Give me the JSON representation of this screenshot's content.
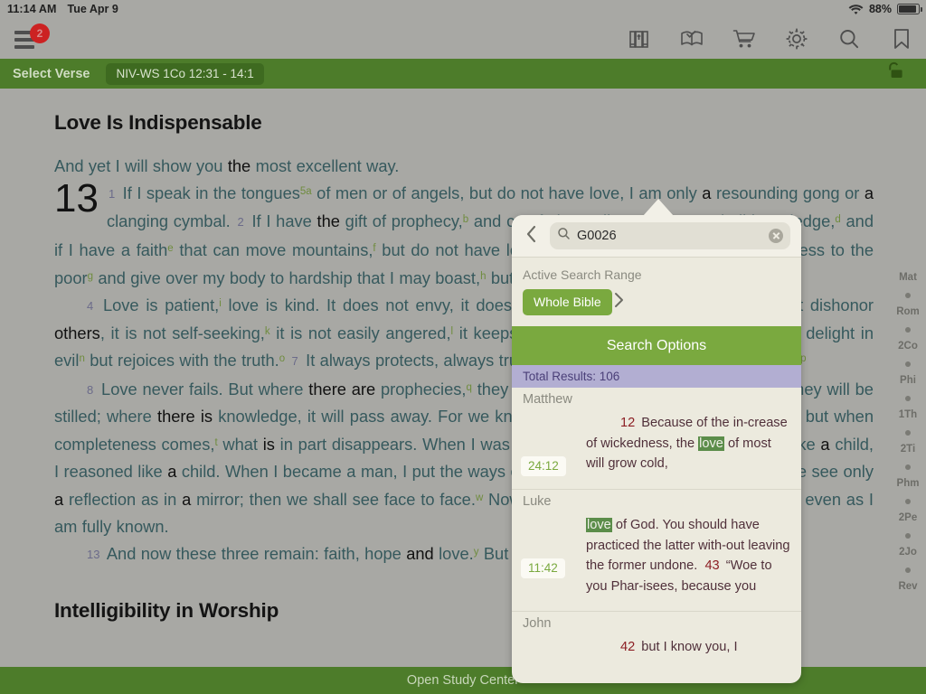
{
  "status_bar": {
    "time": "11:14 AM",
    "date": "Tue Apr 9",
    "battery_percent": "88%",
    "wifi_icon": "wifi-icon",
    "battery_icon": "battery-icon"
  },
  "toolbar": {
    "menu_icon": "hamburger-menu-icon",
    "notification_count": "2",
    "icons": [
      {
        "name": "library-books-icon",
        "label": "Library"
      },
      {
        "name": "study-book-check-icon",
        "label": "Reading Plan"
      },
      {
        "name": "shopping-cart-icon",
        "label": "Store"
      },
      {
        "name": "gear-icon",
        "label": "Settings"
      },
      {
        "name": "search-icon",
        "label": "Search"
      },
      {
        "name": "bookmark-icon",
        "label": "Bookmarks"
      }
    ]
  },
  "verse_bar": {
    "select_verse_label": "Select Verse",
    "reference_chip": "NIV-WS 1Co 12:31 - 14:1",
    "lock_icon": "unlocked-padlock-icon",
    "bar_color": "#4d7c2a"
  },
  "bible": {
    "section_title_1": "Love Is Indispensable",
    "section_title_2": "Intelligibility in Worship",
    "chapter_number": "13",
    "intro_line": "And yet I will show you the most excellent way.",
    "paragraph_1": "If I speak in the tongues5a of men or of angels, but do not have love, I am only a resounding gong or a clanging cymbal. 2 If I have the gift of prophecy,b and can fathom all mysteriesc and all knowledge,d and if I have a faithe that can move mountains,f but do not have love, I am nothing. 3 If I give all I possess to the poorg and give over my body to hardship that I may boast,h but do not have love, I gain nothing.",
    "paragraph_2": "4 Love is patient,i love is kind. It does not envy, it does not boast, it is not proud.j It does not dishonor others, it is not self-seeking,k it is not easily angered,l it keeps no record of wrongs.m 6 Love does not delight in eviln but rejoices with the truth.o 7 It always protects, always trusts, always hopes, always perseveres.p",
    "paragraph_3": "8 Love never fails. But where there are prophecies,q they will cease; where there are tongues,r they will be stilled; where there is knowledge, it will pass away.s 9 For we know in part and we prophesy in part, 10 but when completeness comes,t what is in part disappears. 11 When I was a child, I talked like a child, I thought like a child, I reasoned like a child. When I became a man, I put the ways of childhoodu behind me. 12 For now we see only a reflection as in a mirror; then we shall see face to face.w Now I know in part; then I shall know fully, even as I am fully known.x",
    "paragraph_4": "13 And now these three remain: faith, hope and love.y But the greatest of these is love.",
    "verse_numbers": [
      "1",
      "2",
      "3",
      "4",
      "6",
      "7",
      "8",
      "9",
      "10",
      "11",
      "12",
      "13"
    ],
    "text_color": "#36595d",
    "footnote_color": "#6f8c3e"
  },
  "book_index_strip": {
    "entries": [
      "Mat",
      "Rom",
      "2Co",
      "Phi",
      "1Th",
      "2Ti",
      "Phm",
      "2Pe",
      "2Jo",
      "Rev"
    ]
  },
  "search_popover": {
    "back_icon": "chevron-left-icon",
    "search_icon": "magnifier-icon",
    "query": "G0026",
    "clear_icon": "clear-circle-icon",
    "active_range_label": "Active Search Range",
    "range_chip": "Whole Bible",
    "range_forward_icon": "chevron-right-icon",
    "search_options_label": "Search Options",
    "total_results_label": "Total Results: 106",
    "highlight_color": "#5b8d4a",
    "accent_green": "#7aa93f",
    "results_banner_color": "#b2aed2",
    "groups": [
      {
        "book": "Matthew",
        "results": [
          {
            "reference": "24:12",
            "verse_number": "12",
            "text_before": "Because of the increase of wickedness, the ",
            "highlight": "love",
            "text_after": " of most will grow cold,"
          }
        ]
      },
      {
        "book": "Luke",
        "results": [
          {
            "reference": "11:42",
            "verse_number": "",
            "text_before": "",
            "highlight": "love",
            "text_after": " of God. You should have practiced the latter without leaving the former undone."
          },
          {
            "reference": "",
            "verse_number": "43",
            "text_before": "“Woe to you Pharisees, because you",
            "highlight": "",
            "text_after": ""
          }
        ]
      },
      {
        "book": "John",
        "results": [
          {
            "reference": "",
            "verse_number": "42",
            "text_before": "but I know you, I",
            "highlight": "",
            "text_after": ""
          }
        ]
      }
    ]
  },
  "bottom_bar": {
    "label": "Open Study Center"
  }
}
